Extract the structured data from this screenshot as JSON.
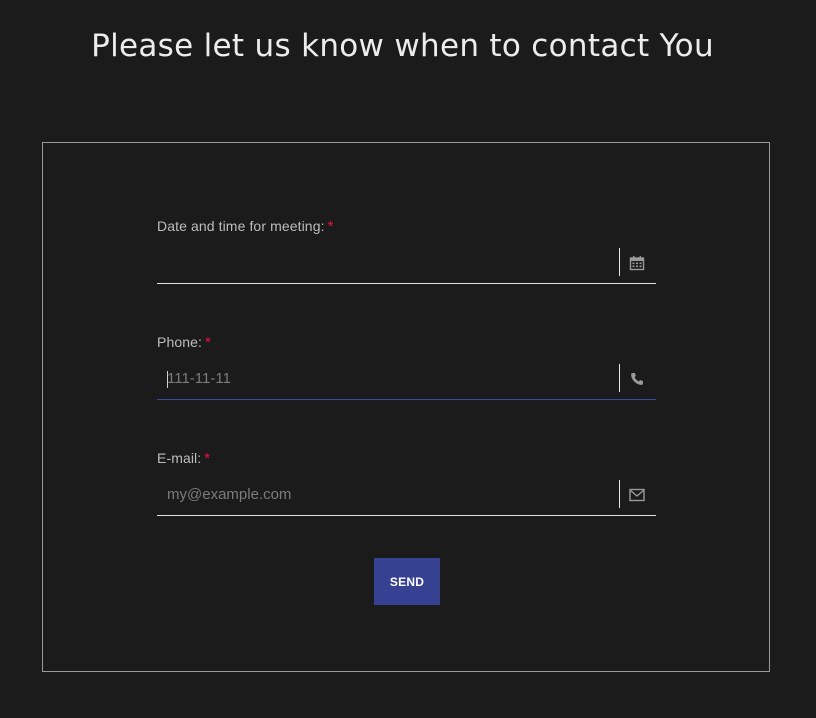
{
  "page": {
    "title": "Please let us know when to contact You"
  },
  "form": {
    "required_marker": "*",
    "fields": [
      {
        "label": "Date and time for meeting:",
        "value": "",
        "placeholder": "",
        "icon": "calendar-icon"
      },
      {
        "label": "Phone:",
        "value": "",
        "placeholder": "111-11-11",
        "icon": "phone-icon",
        "focused": true
      },
      {
        "label": "E-mail:",
        "value": "",
        "placeholder": "my@example.com",
        "icon": "envelope-icon"
      }
    ],
    "submit_label": "SEND"
  },
  "colors": {
    "background": "#1b1b1b",
    "button": "#374192",
    "required_star": "#e8123c",
    "focus_underline": "#3a4a9e"
  }
}
